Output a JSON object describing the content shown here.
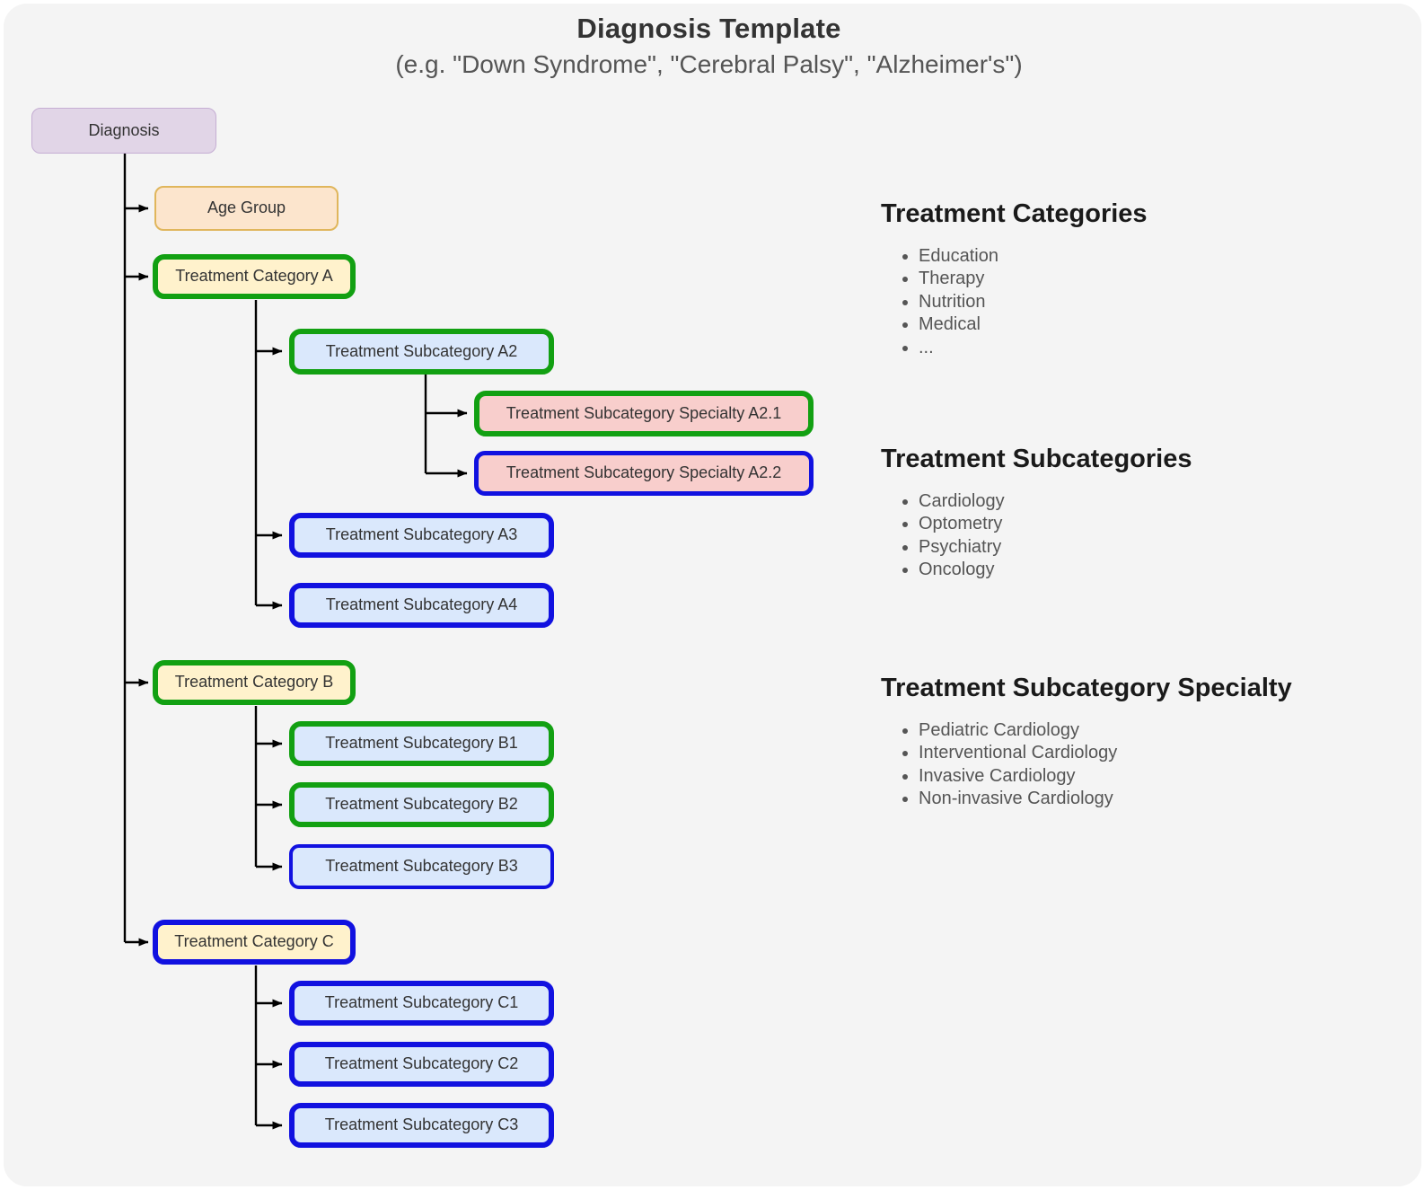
{
  "header": {
    "title": "Diagnosis Template",
    "subtitle": "(e.g. \"Down Syndrome\", \"Cerebral Palsy\", \"Alzheimer's\")"
  },
  "diagram": {
    "root": {
      "label": "Diagnosis"
    },
    "age_group": {
      "label": "Age Group"
    },
    "category_a": {
      "label": "Treatment Category A"
    },
    "subcat_a2": {
      "label": "Treatment Subcategory A2"
    },
    "specialty_a21": {
      "label": "Treatment Subcategory Specialty A2.1"
    },
    "specialty_a22": {
      "label": "Treatment Subcategory Specialty A2.2"
    },
    "subcat_a3": {
      "label": "Treatment Subcategory A3"
    },
    "subcat_a4": {
      "label": "Treatment Subcategory A4"
    },
    "category_b": {
      "label": "Treatment Category B"
    },
    "subcat_b1": {
      "label": "Treatment Subcategory B1"
    },
    "subcat_b2": {
      "label": "Treatment Subcategory B2"
    },
    "subcat_b3": {
      "label": "Treatment Subcategory B3"
    },
    "category_c": {
      "label": "Treatment Category C"
    },
    "subcat_c1": {
      "label": "Treatment Subcategory C1"
    },
    "subcat_c2": {
      "label": "Treatment Subcategory C2"
    },
    "subcat_c3": {
      "label": "Treatment Subcategory C3"
    }
  },
  "legend": {
    "categories": {
      "title": "Treatment Categories",
      "items": [
        "Education",
        "Therapy",
        "Nutrition",
        "Medical",
        "..."
      ]
    },
    "subcategories": {
      "title": "Treatment Subcategories",
      "items": [
        "Cardiology",
        "Optometry",
        "Psychiatry",
        "Oncology"
      ]
    },
    "specialty": {
      "title": "Treatment Subcategory Specialty",
      "items": [
        "Pediatric Cardiology",
        "Interventional Cardiology",
        "Invasive Cardiology",
        "Non-invasive Cardiology"
      ]
    }
  },
  "colors": {
    "canvas": "#f4f4f4",
    "green_border": "#12a012",
    "blue_border": "#1111e0",
    "purple_fill": "#e1d5e7",
    "orange_fill": "#fce5cd",
    "yellow_fill": "#fff2cc",
    "blue_fill": "#dae8fc",
    "pink_fill": "#f8cecc",
    "edge": "#000000"
  }
}
